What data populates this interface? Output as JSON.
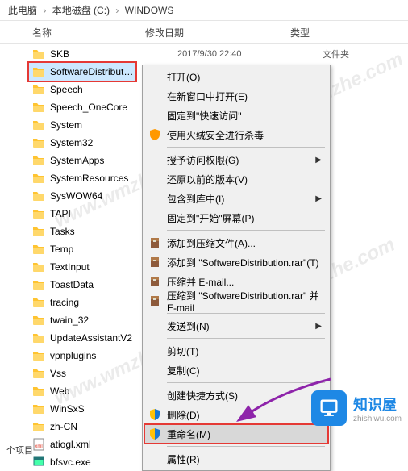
{
  "breadcrumb": {
    "p1": "此电脑",
    "p2": "本地磁盘 (C:)",
    "p3": "WINDOWS"
  },
  "columns": {
    "name": "名称",
    "date": "修改日期",
    "type": "类型"
  },
  "first_row": {
    "name": "SKB",
    "date": "2017/9/30 22:40",
    "type": "文件夹"
  },
  "folders": [
    "SoftwareDistribution",
    "Speech",
    "Speech_OneCore",
    "System",
    "System32",
    "SystemApps",
    "SystemResources",
    "SysWOW64",
    "TAPI",
    "Tasks",
    "Temp",
    "TextInput",
    "ToastData",
    "tracing",
    "twain_32",
    "UpdateAssistantV2",
    "vpnplugins",
    "Vss",
    "Web",
    "WinSxS",
    "zh-CN"
  ],
  "files": [
    {
      "name": "atiogl.xml",
      "icon": "xml"
    },
    {
      "name": "bfsvc.exe",
      "icon": "exe"
    }
  ],
  "menu": {
    "open": "打开(O)",
    "open_new_window": "在新窗口中打开(E)",
    "pin_quick": "固定到\"快速访问\"",
    "huorong": "使用火绒安全进行杀毒",
    "grant_access": "授予访问权限(G)",
    "restore_prev": "还原以前的版本(V)",
    "include_lib": "包含到库中(I)",
    "pin_start": "固定到\"开始\"屏幕(P)",
    "add_archive": "添加到压缩文件(A)...",
    "add_rar": "添加到 \"SoftwareDistribution.rar\"(T)",
    "compress_email": "压缩并 E-mail...",
    "compress_rar_email": "压缩到 \"SoftwareDistribution.rar\" 并 E-mail",
    "send_to": "发送到(N)",
    "cut": "剪切(T)",
    "copy": "复制(C)",
    "create_shortcut": "创建快捷方式(S)",
    "delete": "删除(D)",
    "rename": "重命名(M)",
    "properties": "属性(R)"
  },
  "watermark": "www.wmzhe.com",
  "logo": {
    "main": "知识屋",
    "sub": "zhishiwu.com"
  },
  "status": "个项目"
}
